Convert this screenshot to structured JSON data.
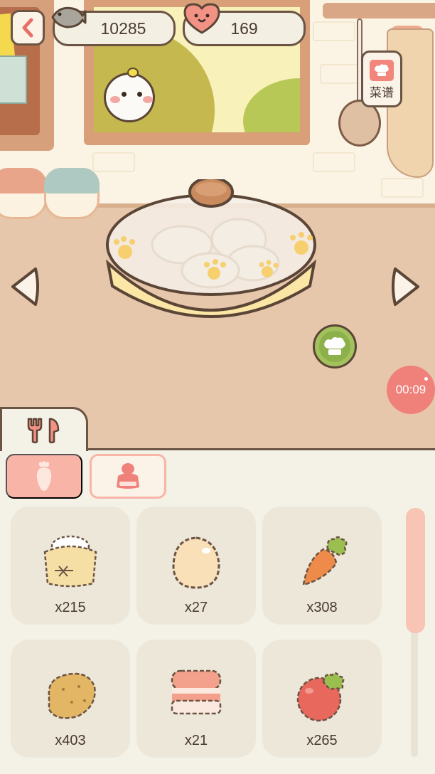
{
  "hud": {
    "coins": "10285",
    "hearts": "169",
    "coin_icon": "fish-coin-icon",
    "heart_icon": "heart-face-icon"
  },
  "recipe_button": {
    "label": "菜谱",
    "icon": "chef-hat-icon"
  },
  "cook_button": {
    "icon": "chef-hat-icon"
  },
  "timer": {
    "value": "00:09"
  },
  "panel": {
    "tab_icon": "utensils-icon",
    "categories": [
      {
        "icon": "carrot-icon",
        "active": true
      },
      {
        "icon": "seasoning-jar-icon",
        "active": false
      }
    ]
  },
  "ingredients": [
    {
      "icon": "flour-icon",
      "count": "x215"
    },
    {
      "icon": "egg-icon",
      "count": "x27"
    },
    {
      "icon": "carrot-icon",
      "count": "x308"
    },
    {
      "icon": "potato-icon",
      "count": "x403"
    },
    {
      "icon": "bacon-icon",
      "count": "x21"
    },
    {
      "icon": "tomato-icon",
      "count": "x265"
    }
  ],
  "colors": {
    "outline": "#6b5444",
    "accent_pink": "#f7b4a7",
    "accent_green": "#a3c15c",
    "timer_red": "#f0807a"
  }
}
